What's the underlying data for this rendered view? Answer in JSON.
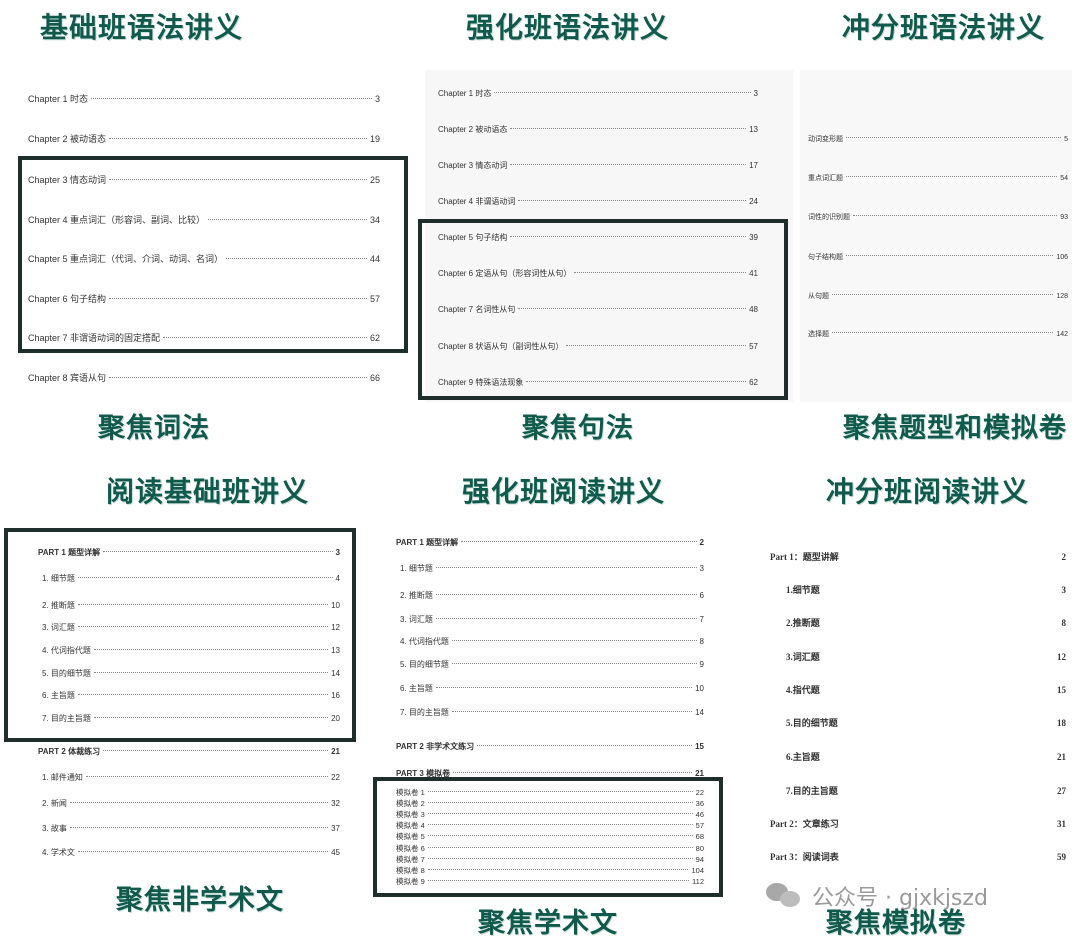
{
  "panels": {
    "p1": {
      "title": "基础班语法讲义",
      "caption": "聚焦词法",
      "rows": [
        {
          "label": "Chapter 1  时态",
          "page": "3"
        },
        {
          "label": "Chapter 2  被动语态",
          "page": "19"
        },
        {
          "label": "Chapter 3  情态动词",
          "page": "25"
        },
        {
          "label": "Chapter 4  重点词汇（形容词、副词、比较）",
          "page": "34"
        },
        {
          "label": "Chapter 5  重点词汇（代词、介词、动词、名词）",
          "page": "44"
        },
        {
          "label": "Chapter 6  句子结构",
          "page": "57"
        },
        {
          "label": "Chapter 7  非谓语动词的固定搭配",
          "page": "62"
        },
        {
          "label": "Chapter 8  宾语从句",
          "page": "66"
        }
      ]
    },
    "p2": {
      "title": "强化班语法讲义",
      "caption": "聚焦句法",
      "rows": [
        {
          "label": "Chapter 1  时态",
          "page": "3"
        },
        {
          "label": "Chapter 2  被动语态",
          "page": "13"
        },
        {
          "label": "Chapter 3  情态动词",
          "page": "17"
        },
        {
          "label": "Chapter 4  非谓语动词",
          "page": "24"
        },
        {
          "label": "Chapter 5  句子结构",
          "page": "39"
        },
        {
          "label": "Chapter 6  定语从句（形容词性从句）",
          "page": "41"
        },
        {
          "label": "Chapter 7  名词性从句",
          "page": "48"
        },
        {
          "label": "Chapter 8  状语从句（副词性从句）",
          "page": "57"
        },
        {
          "label": "Chapter 9  特殊语法现象",
          "page": "62"
        }
      ]
    },
    "p3": {
      "title": "冲分班语法讲义",
      "caption": "聚焦题型和模拟卷",
      "rows": [
        {
          "label": "动词变形题",
          "page": "5"
        },
        {
          "label": "重点词汇题",
          "page": "54"
        },
        {
          "label": "词性的识别题",
          "page": "93"
        },
        {
          "label": "句子结构题",
          "page": "106"
        },
        {
          "label": "从句题",
          "page": "128"
        },
        {
          "label": "选择题",
          "page": "142"
        }
      ]
    },
    "p4": {
      "title": "阅读基础班讲义",
      "caption": "聚焦非学术文",
      "rows": [
        {
          "label": "PART 1  题型详解",
          "page": "3"
        },
        {
          "label": "1.   细节题",
          "page": "4"
        },
        {
          "label": "2.   推断题",
          "page": "10"
        },
        {
          "label": "3.   词汇题",
          "page": "12"
        },
        {
          "label": "4.   代词指代题",
          "page": "13"
        },
        {
          "label": "5.   目的细节题",
          "page": "14"
        },
        {
          "label": "6.   主旨题",
          "page": "16"
        },
        {
          "label": "7.   目的主旨题",
          "page": "20"
        },
        {
          "label": "PART 2  体裁练习",
          "page": "21"
        },
        {
          "label": "1.   邮件通知",
          "page": "22"
        },
        {
          "label": "2.   新闻",
          "page": "32"
        },
        {
          "label": "3.   故事",
          "page": "37"
        },
        {
          "label": "4.   学术文",
          "page": "45"
        }
      ]
    },
    "p5": {
      "title": "强化班阅读讲义",
      "caption": "聚焦学术文",
      "rows": [
        {
          "label": "PART 1  题型详解",
          "page": "2"
        },
        {
          "label": "1.   细节题",
          "page": "3"
        },
        {
          "label": "2.   推断题",
          "page": "6"
        },
        {
          "label": "3.   词汇题",
          "page": "7"
        },
        {
          "label": "4.   代词指代题",
          "page": "8"
        },
        {
          "label": "5.   目的细节题",
          "page": "9"
        },
        {
          "label": "6.   主旨题",
          "page": "10"
        },
        {
          "label": "7.   目的主旨题",
          "page": "14"
        },
        {
          "label": "PART 2  非学术文练习",
          "page": "15"
        },
        {
          "label": "PART 3  模拟卷",
          "page": "21"
        },
        {
          "label": "模拟卷 1",
          "page": "22"
        },
        {
          "label": "模拟卷 2",
          "page": "36"
        },
        {
          "label": "模拟卷 3",
          "page": "46"
        },
        {
          "label": "模拟卷 4",
          "page": "57"
        },
        {
          "label": "模拟卷 5",
          "page": "68"
        },
        {
          "label": "模拟卷 6",
          "page": "80"
        },
        {
          "label": "模拟卷 7",
          "page": "94"
        },
        {
          "label": "模拟卷 8",
          "page": "104"
        },
        {
          "label": "模拟卷 9",
          "page": "112"
        }
      ]
    },
    "p6": {
      "title": "冲分班阅读讲义",
      "caption": "聚焦模拟卷",
      "rows": [
        {
          "label": "Part 1：题型讲解",
          "page": "2"
        },
        {
          "label": "1.细节题",
          "page": "3"
        },
        {
          "label": "2.推断题",
          "page": "8"
        },
        {
          "label": "3.词汇题",
          "page": "12"
        },
        {
          "label": "4.指代题",
          "page": "15"
        },
        {
          "label": "5.目的细节题",
          "page": "18"
        },
        {
          "label": "6.主旨题",
          "page": "21"
        },
        {
          "label": "7.目的主旨题",
          "page": "27"
        },
        {
          "label": "Part 2：文章练习",
          "page": "31"
        },
        {
          "label": "Part 3：阅读词表",
          "page": "59"
        }
      ]
    }
  },
  "watermark": {
    "text": "公众号 · gjxkjszd",
    "icon": "wechat-icon"
  }
}
